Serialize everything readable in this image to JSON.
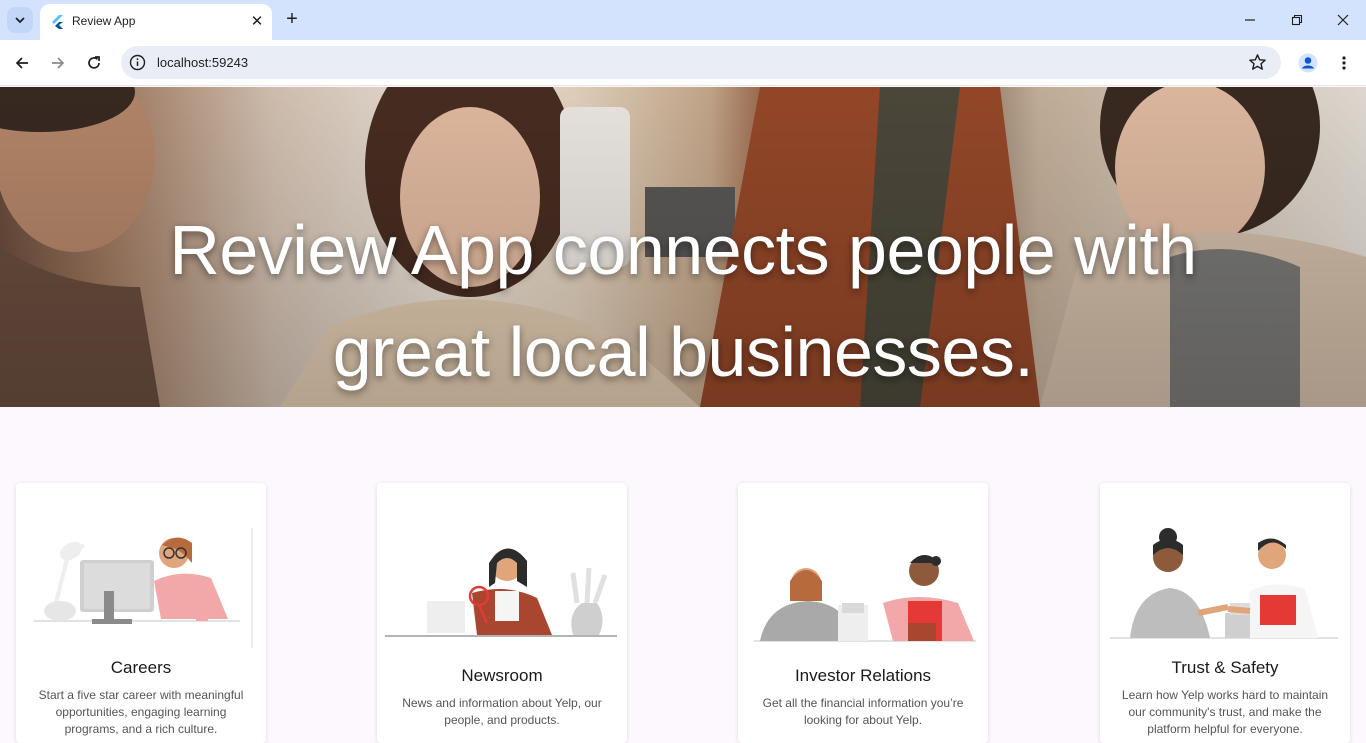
{
  "browser": {
    "tab_title": "Review App",
    "url": "localhost:59243"
  },
  "hero": {
    "line1": "Review App connects people with",
    "line2": "great local businesses."
  },
  "cards": [
    {
      "title": "Careers",
      "description": "Start a five star career with meaningful opportunities, engaging learning programs, and a rich culture."
    },
    {
      "title": "Newsroom",
      "description": "News and information about Yelp, our people, and products."
    },
    {
      "title": "Investor Relations",
      "description": "Get all the financial information you’re looking for about Yelp."
    },
    {
      "title": "Trust & Safety",
      "description": "Learn how Yelp works hard to maintain our community's trust, and make the platform helpful for everyone."
    }
  ],
  "colors": {
    "page_background": "#fdf7fe",
    "tabstrip": "#d3e3fd",
    "accent_pink": "#f2a7a9",
    "accent_red": "#e53935"
  }
}
